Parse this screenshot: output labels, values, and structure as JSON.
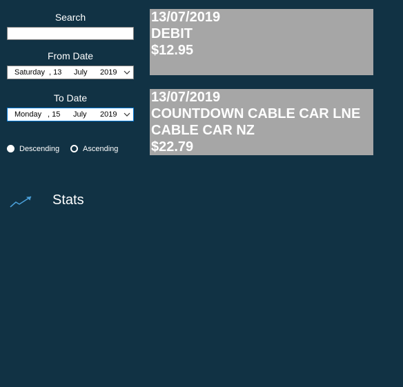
{
  "filters": {
    "search_label": "Search",
    "search_value": "",
    "from_label": "From Date",
    "from_date": {
      "weekday": "Saturday",
      "day": ", 13",
      "month": "July",
      "year": "2019"
    },
    "to_label": "To Date",
    "to_date": {
      "weekday": "Monday",
      "day": ", 15",
      "month": "July",
      "year": "2019"
    },
    "sort": {
      "descending_label": "Descending",
      "ascending_label": "Ascending",
      "selected": "Ascending"
    }
  },
  "transactions": [
    {
      "date": "13/07/2019",
      "lines": [
        "DEBIT"
      ],
      "amount": "$12.95"
    },
    {
      "date": "13/07/2019",
      "lines": [
        "COUNTDOWN CABLE CAR LNE",
        "CABLE CAR NZ"
      ],
      "amount": "$22.79"
    }
  ],
  "nav": {
    "stats_label": "Stats",
    "stats_icon": "trend-up-icon"
  },
  "colors": {
    "background": "#113244",
    "card": "#a6a6a6",
    "accent": "#4a9fd8"
  }
}
